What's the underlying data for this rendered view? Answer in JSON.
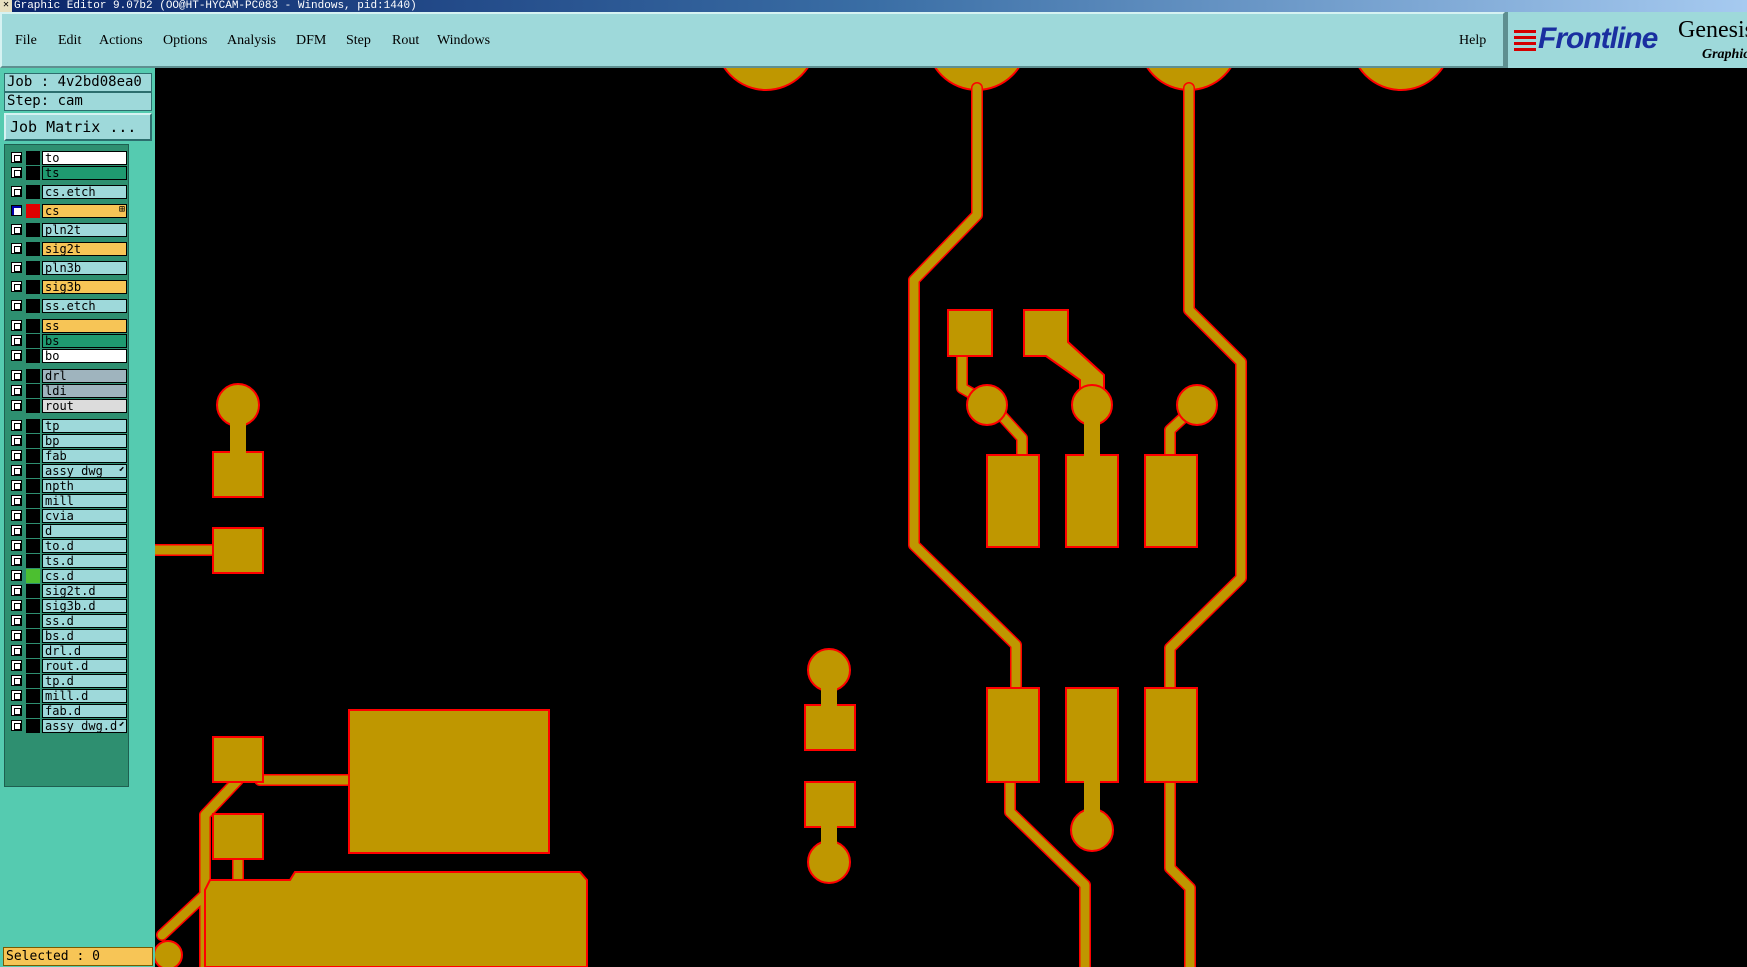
{
  "window": {
    "title": "Graphic Editor 9.07b2 (OO@HT-HYCAM-PC083 - Windows, pid:1440)"
  },
  "menu": {
    "items": [
      "File",
      "Edit",
      "Actions",
      "Options",
      "Analysis",
      "DFM",
      "Step",
      "Rout",
      "Windows"
    ],
    "help": "Help"
  },
  "logo": {
    "brand": "Frontline",
    "product": "Genesis",
    "subtitle": "Graphic"
  },
  "job": {
    "job_label": "Job : 4v2bd08ea0",
    "step_label": "Step: cam",
    "matrix_button": "Job Matrix ..."
  },
  "layers": [
    {
      "name": "to",
      "color": "#ffffff",
      "group": 0
    },
    {
      "name": "ts",
      "color": "#1f9a70",
      "group": 0
    },
    {
      "name": "cs.etch",
      "color": "#9ed9da",
      "group": 1
    },
    {
      "name": "cs",
      "color": "#f7c556",
      "group": 1,
      "active": true,
      "swatch": "#e00000",
      "mark": "⊞"
    },
    {
      "name": "pln2t",
      "color": "#9ed9da",
      "group": 1
    },
    {
      "name": "sig2t",
      "color": "#f7c556",
      "group": 1
    },
    {
      "name": "pln3b",
      "color": "#9ed9da",
      "group": 1
    },
    {
      "name": "sig3b",
      "color": "#f7c556",
      "group": 1
    },
    {
      "name": "ss.etch",
      "color": "#9ed9da",
      "group": 1
    },
    {
      "name": "ss",
      "color": "#f7c556",
      "group": 2
    },
    {
      "name": "bs",
      "color": "#1f9a70",
      "group": 2
    },
    {
      "name": "bo",
      "color": "#ffffff",
      "group": 2
    },
    {
      "name": "drl",
      "color": "#9fb4be",
      "group": 3
    },
    {
      "name": "ldi",
      "color": "#9fb4be",
      "group": 3
    },
    {
      "name": "rout",
      "color": "#dcdcdc",
      "group": 3
    },
    {
      "name": "tp",
      "color": "#9ed9da",
      "group": 4
    },
    {
      "name": "bp",
      "color": "#9ed9da",
      "group": 4
    },
    {
      "name": "fab",
      "color": "#9ed9da",
      "group": 4
    },
    {
      "name": "assy_dwg",
      "color": "#9ed9da",
      "group": 4,
      "mark": "⬋"
    },
    {
      "name": "npth",
      "color": "#9ed9da",
      "group": 4
    },
    {
      "name": "mill",
      "color": "#9ed9da",
      "group": 4
    },
    {
      "name": "cvia",
      "color": "#9ed9da",
      "group": 4
    },
    {
      "name": "d",
      "color": "#9ed9da",
      "group": 4
    },
    {
      "name": "to.d",
      "color": "#9ed9da",
      "group": 4
    },
    {
      "name": "ts.d",
      "color": "#9ed9da",
      "group": 4
    },
    {
      "name": "cs.d",
      "color": "#9ed9da",
      "group": 4,
      "swatch": "#4cbf30"
    },
    {
      "name": "sig2t.d",
      "color": "#9ed9da",
      "group": 4
    },
    {
      "name": "sig3b.d",
      "color": "#9ed9da",
      "group": 4
    },
    {
      "name": "ss.d",
      "color": "#9ed9da",
      "group": 4
    },
    {
      "name": "bs.d",
      "color": "#9ed9da",
      "group": 4
    },
    {
      "name": "drl.d",
      "color": "#9ed9da",
      "group": 4
    },
    {
      "name": "rout.d",
      "color": "#9ed9da",
      "group": 4
    },
    {
      "name": "tp.d",
      "color": "#9ed9da",
      "group": 4
    },
    {
      "name": "mill.d",
      "color": "#9ed9da",
      "group": 4
    },
    {
      "name": "fab.d",
      "color": "#9ed9da",
      "group": 4
    },
    {
      "name": "assy_dwg.d",
      "color": "#9ed9da",
      "group": 4,
      "mark": "⬋"
    }
  ],
  "status": {
    "selected": "Selected : 0"
  },
  "colors": {
    "copper": "#bf9700",
    "outline": "#ff0000",
    "background": "#000000"
  }
}
